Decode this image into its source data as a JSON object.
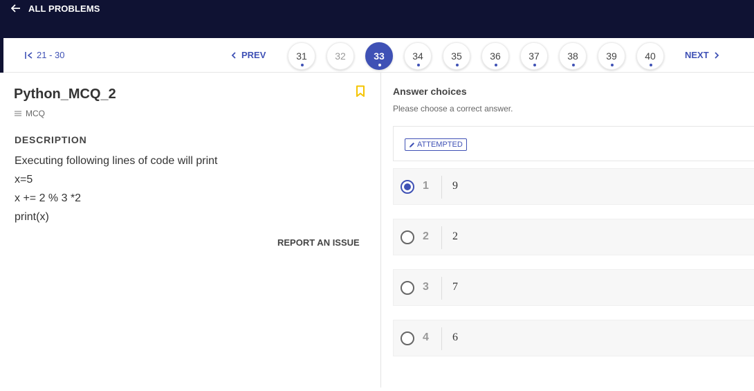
{
  "header": {
    "back_label": "ALL PROBLEMS"
  },
  "pager": {
    "range_label": "21 - 30",
    "prev_label": "PREV",
    "next_label": "NEXT",
    "pages": [
      {
        "label": "31",
        "state": "dot"
      },
      {
        "label": "32",
        "state": "muted"
      },
      {
        "label": "33",
        "state": "current"
      },
      {
        "label": "34",
        "state": "dot"
      },
      {
        "label": "35",
        "state": "dot"
      },
      {
        "label": "36",
        "state": "dot"
      },
      {
        "label": "37",
        "state": "dot"
      },
      {
        "label": "38",
        "state": "dot"
      },
      {
        "label": "39",
        "state": "dot"
      },
      {
        "label": "40",
        "state": "dot"
      }
    ],
    "accent_color": "#3f51b5"
  },
  "problem": {
    "title": "Python_MCQ_2",
    "type": "MCQ",
    "description_heading": "DESCRIPTION",
    "description_lines": [
      "Executing following lines of code will print",
      "x=5",
      "x += 2 % 3 *2",
      "print(x)"
    ],
    "report_label": "REPORT AN ISSUE",
    "bookmark_color": "#f5c400"
  },
  "answers": {
    "heading": "Answer choices",
    "subheading": "Please choose a correct answer.",
    "status": "ATTEMPTED",
    "options": [
      {
        "num": "1",
        "value": "9",
        "selected": true
      },
      {
        "num": "2",
        "value": "2",
        "selected": false
      },
      {
        "num": "3",
        "value": "7",
        "selected": false
      },
      {
        "num": "4",
        "value": "6",
        "selected": false
      }
    ]
  },
  "icons": {
    "back": "arrow-left-icon",
    "first": "first-page-icon",
    "prev": "chevron-left-icon",
    "next": "chevron-right-icon",
    "bookmark": "bookmark-icon",
    "type": "list-icon",
    "status": "pencil-icon"
  }
}
